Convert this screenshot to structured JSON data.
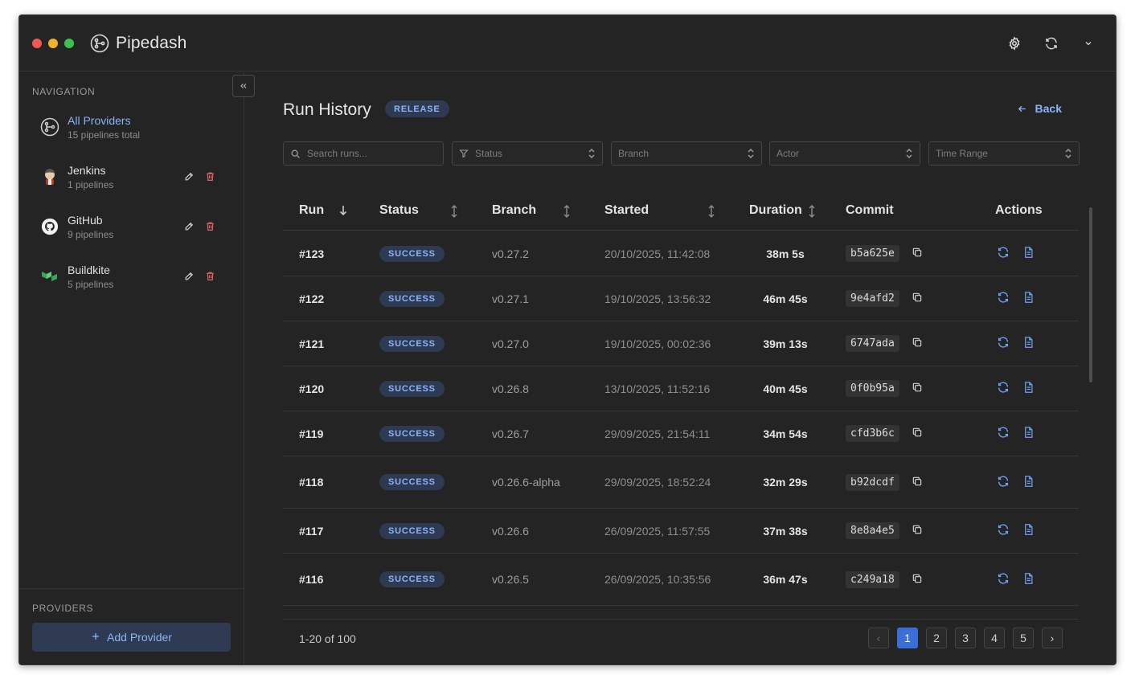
{
  "app": {
    "name": "Pipedash"
  },
  "sidebar": {
    "nav_heading": "NAVIGATION",
    "items": [
      {
        "name": "All Providers",
        "sub": "15 pipelines total"
      },
      {
        "name": "Jenkins",
        "sub": "1 pipelines"
      },
      {
        "name": "GitHub",
        "sub": "9 pipelines"
      },
      {
        "name": "Buildkite",
        "sub": "5 pipelines"
      }
    ],
    "providers_heading": "PROVIDERS",
    "add_provider_label": "Add Provider"
  },
  "main": {
    "title": "Run History",
    "tag": "RELEASE",
    "back_label": "Back",
    "filters": {
      "search_placeholder": "Search runs...",
      "status": "Status",
      "branch": "Branch",
      "actor": "Actor",
      "time_range": "Time Range"
    },
    "columns": [
      "Run",
      "Status",
      "Branch",
      "Started",
      "Duration",
      "Commit",
      "Actions"
    ],
    "rows": [
      {
        "run": "#123",
        "status": "SUCCESS",
        "branch": "v0.27.2",
        "started": "20/10/2025, 11:42:08",
        "duration": "38m 5s",
        "commit": "b5a625e"
      },
      {
        "run": "#122",
        "status": "SUCCESS",
        "branch": "v0.27.1",
        "started": "19/10/2025, 13:56:32",
        "duration": "46m 45s",
        "commit": "9e4afd2"
      },
      {
        "run": "#121",
        "status": "SUCCESS",
        "branch": "v0.27.0",
        "started": "19/10/2025, 00:02:36",
        "duration": "39m 13s",
        "commit": "6747ada"
      },
      {
        "run": "#120",
        "status": "SUCCESS",
        "branch": "v0.26.8",
        "started": "13/10/2025, 11:52:16",
        "duration": "40m 45s",
        "commit": "0f0b95a"
      },
      {
        "run": "#119",
        "status": "SUCCESS",
        "branch": "v0.26.7",
        "started": "29/09/2025, 21:54:11",
        "duration": "34m 54s",
        "commit": "cfd3b6c"
      },
      {
        "run": "#118",
        "status": "SUCCESS",
        "branch": "v0.26.6-alpha",
        "started": "29/09/2025, 18:52:24",
        "duration": "32m 29s",
        "commit": "b92dcdf"
      },
      {
        "run": "#117",
        "status": "SUCCESS",
        "branch": "v0.26.6",
        "started": "26/09/2025, 11:57:55",
        "duration": "37m 38s",
        "commit": "8e8a4e5"
      },
      {
        "run": "#116",
        "status": "SUCCESS",
        "branch": "v0.26.5",
        "started": "26/09/2025, 10:35:56",
        "duration": "36m 47s",
        "commit": "c249a18"
      }
    ],
    "pagination": {
      "summary": "1-20 of 100",
      "pages": [
        "1",
        "2",
        "3",
        "4",
        "5"
      ],
      "prev": "‹",
      "next": "›"
    }
  }
}
